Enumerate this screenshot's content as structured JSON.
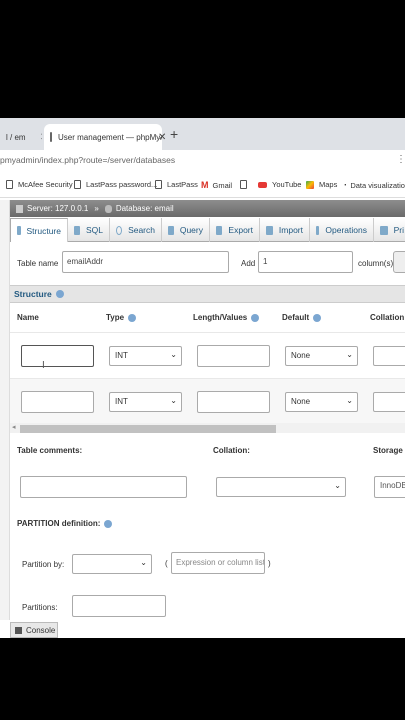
{
  "browser": {
    "tabs": [
      {
        "label": "l / em"
      },
      {
        "label": "User management — phpMyAdm"
      }
    ],
    "new_tab": "+",
    "close_glyph": "✕",
    "address": "pmyadmin/index.php?route=/server/databases",
    "bookmarks": [
      "McAfee Security",
      "LastPass password...",
      "LastPass",
      "Gmail",
      "YouTube",
      "Maps",
      "Data visualizatio"
    ]
  },
  "pma": {
    "breadcrumb": {
      "server": "Server: 127.0.0.1",
      "separator": "»",
      "database": "Database: email"
    },
    "menu": [
      "Structure",
      "SQL",
      "Search",
      "Query",
      "Export",
      "Import",
      "Operations",
      "Pri"
    ],
    "table_name_label": "Table name",
    "table_name_value": "emailAddr",
    "add_label": "Add",
    "add_value": "1",
    "columns_label": "column(s)",
    "structure_label": "Structure",
    "columns": {
      "name": "Name",
      "type": "Type",
      "length": "Length/Values",
      "default": "Default",
      "collation": "Collation"
    },
    "rows": [
      {
        "name": "",
        "type": "INT",
        "length": "",
        "default": "None"
      },
      {
        "name": "",
        "type": "INT",
        "length": "",
        "default": "None"
      }
    ],
    "table_comments_label": "Table comments:",
    "collation_label": "Collation:",
    "storage_label": "Storage E",
    "storage_value": "InnoDB",
    "partition_label": "PARTITION definition:",
    "partition_by_label": "Partition by:",
    "open_paren": "(",
    "close_paren": ")",
    "expression_placeholder": "Expression or column list",
    "partitions_label": "Partitions:",
    "console": "Console"
  },
  "colors": {
    "link": "#235a81",
    "nav_bg": "#777777",
    "help": "#7ba6d1"
  }
}
